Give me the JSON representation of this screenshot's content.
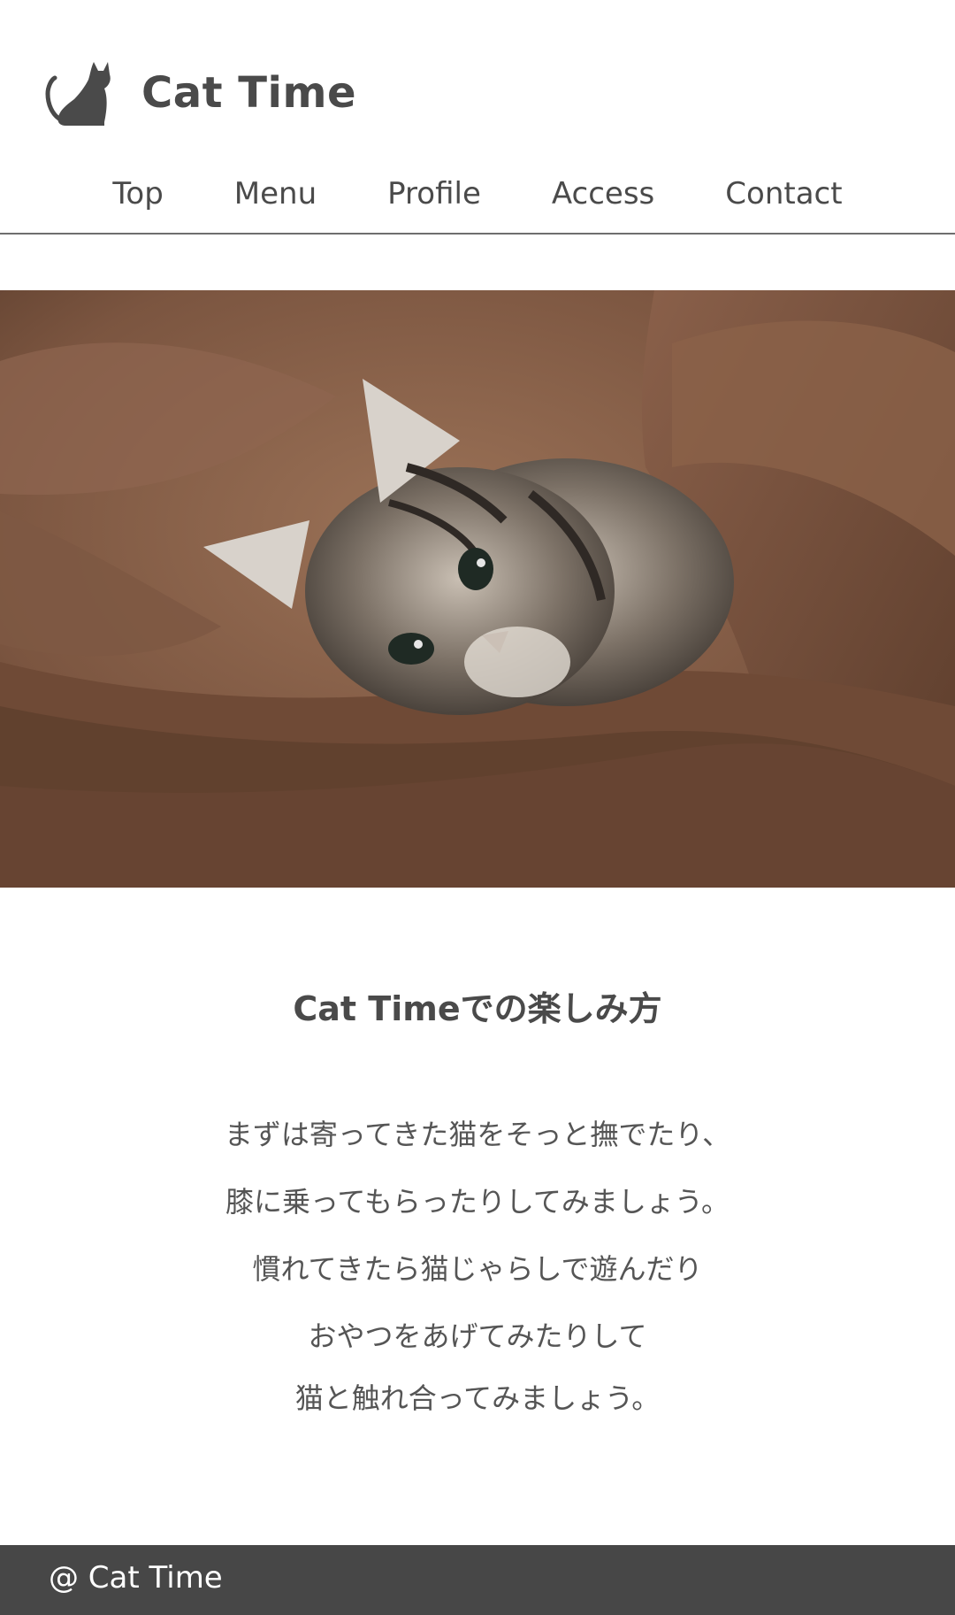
{
  "site": {
    "title": "Cat Time",
    "logo_icon": "cat-silhouette-icon"
  },
  "nav": {
    "items": [
      {
        "label": "Top"
      },
      {
        "label": "Menu"
      },
      {
        "label": "Profile"
      },
      {
        "label": "Access"
      },
      {
        "label": "Contact"
      }
    ]
  },
  "hero": {
    "image": "photo of a tabby kitten lying in a brown blanket"
  },
  "content": {
    "heading": "Cat Timeでの楽しみ方",
    "lines": [
      "まずは寄ってきた猫をそっと撫でたり、",
      "膝に乗ってもらったりしてみましょう。",
      "慣れてきたら猫じゃらしで遊んだり",
      "おやつをあげてみたりして",
      "猫と触れ合ってみましょう。"
    ]
  },
  "footer": {
    "text": "@ Cat Time"
  },
  "colors": {
    "text": "#4a4a4a",
    "footer_bg": "#474747",
    "footer_text": "#ffffff",
    "blanket": "#7a5640"
  }
}
